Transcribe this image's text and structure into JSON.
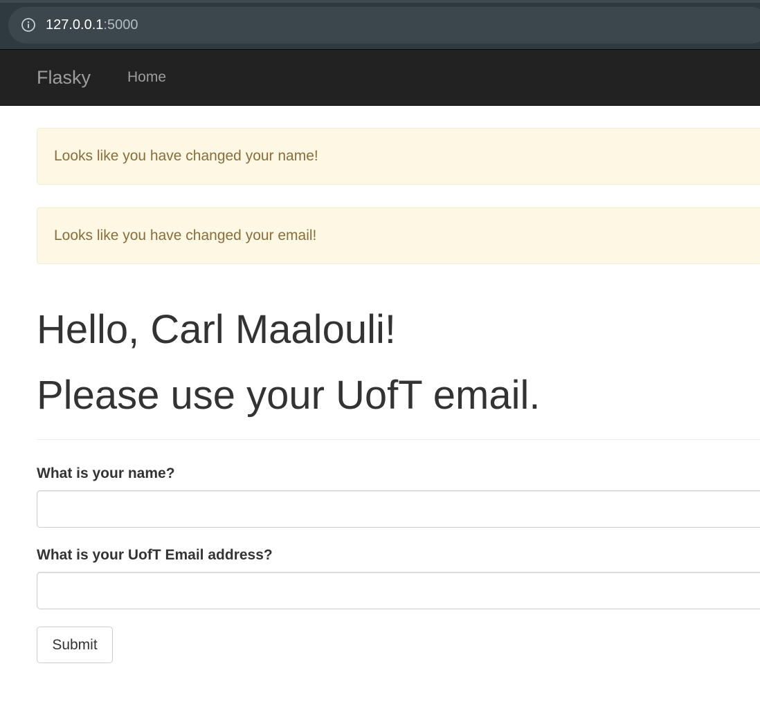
{
  "browser": {
    "url_host": "127.0.0.1",
    "url_port": ":5000",
    "info_icon": "info-icon"
  },
  "navbar": {
    "brand": "Flasky",
    "home_label": "Home"
  },
  "alerts": [
    {
      "text": "Looks like you have changed your name!"
    },
    {
      "text": "Looks like you have changed your email!"
    }
  ],
  "page": {
    "greeting": "Hello, Carl Maalouli!",
    "instruction": "Please use your UofT email."
  },
  "form": {
    "name_label": "What is your name?",
    "name_value": "",
    "email_label": "What is your UofT Email address?",
    "email_value": "",
    "submit_label": "Submit"
  },
  "colors": {
    "navbar_bg": "#222222",
    "nav_text": "#9d9d9d",
    "alert_bg": "#fcf8e3",
    "alert_text": "#8a6d3b",
    "browser_bar": "#2f3a40"
  }
}
